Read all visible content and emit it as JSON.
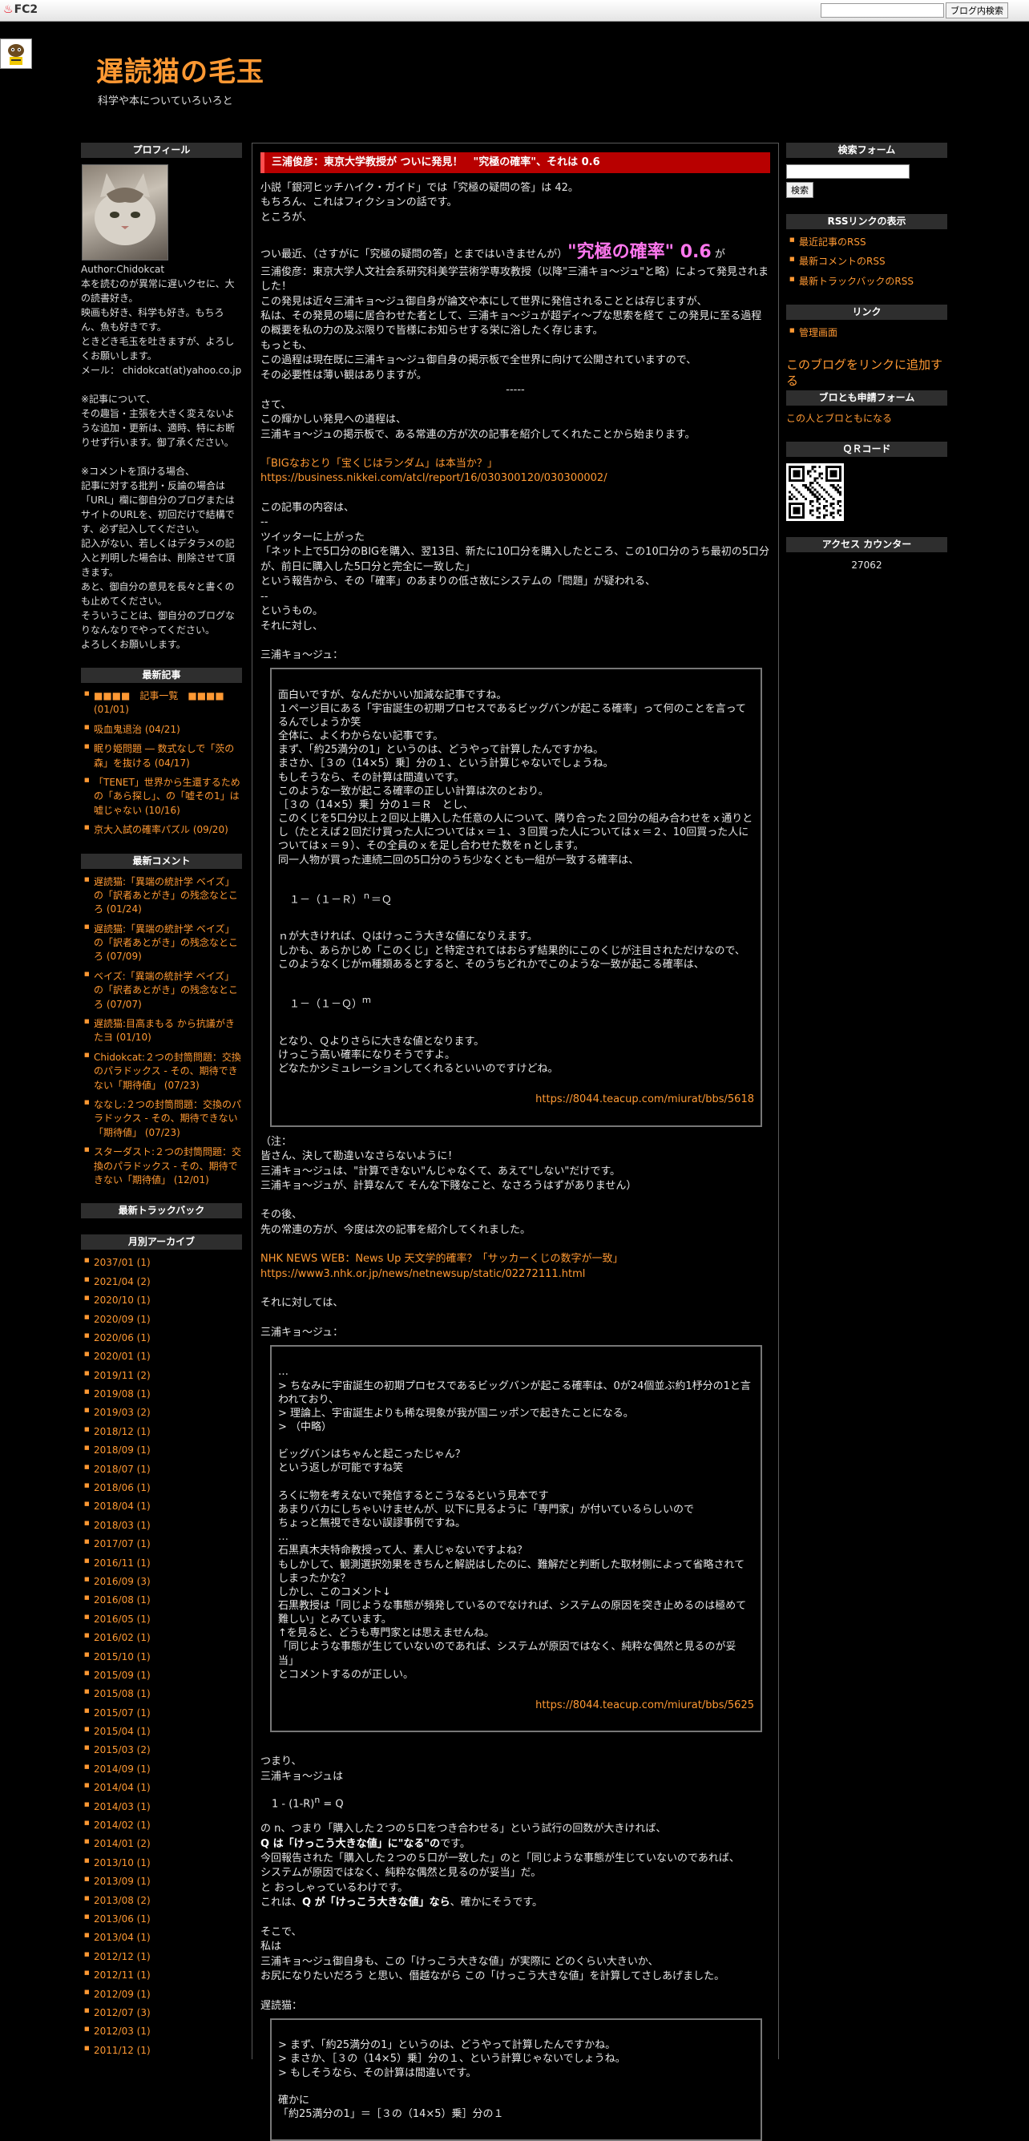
{
  "topbar": {
    "logo": "FC2",
    "search_placeholder": "",
    "blog_search_button": "ブログ内検索"
  },
  "header": {
    "title": "遅読猫の毛玉",
    "subtitle": "科学や本についていろいろと"
  },
  "profile": {
    "heading": "プロフィール",
    "author": "Author:Chidokcat",
    "text": "本を読むのが異常に遅いクセに、大の読書好き。\n映画も好き、科学も好き。もちろん、魚も好きです。\nときどき毛玉を吐きますが、よろしくお願いします。\nメール： chidokcat(at)yahoo.co.jp\n\n※記事について、\nその趣旨・主張を大きく変えないような追加・更新は、適時、特にお断りせず行います。御了承ください。\n\n※コメントを頂ける場合、\n記事に対する批判・反論の場合は「URL」欄に御自分のブログまたはサイトのURLを、初回だけで結構です、必ず記入してください。\n記入がない、若しくはデタラメの記入と判明した場合は、削除させて頂きます。\nあと、御自分の意見を長々と書くのも止めてください。\nそういうことは、御自分のブログなりなんなりでやってください。\nよろしくお願いします。"
  },
  "recent_articles": {
    "heading": "最新記事",
    "items": [
      "■■■■　記事一覧　■■■■ (01/01)",
      "吸血鬼退治 (04/21)",
      "眠り姫問題 ― 数式なしで「茨の森」を抜ける (04/17)",
      "「TENET」世界から生還するための「あら探し」、の「嘘その1」は嘘じゃない (10/16)",
      "京大入試の確率パズル (09/20)"
    ]
  },
  "recent_comments": {
    "heading": "最新コメント",
    "items": [
      "遅読猫:「異端の統計学 ベイズ」の「訳者あとがき」の残念なところ (01/24)",
      "遅読猫:「異端の統計学 ベイズ」の「訳者あとがき」の残念なところ (07/09)",
      "ベイズ:「異端の統計学 ベイズ」の「訳者あとがき」の残念なところ (07/07)",
      "遅読猫:目高まもる から抗議がきたヨ (01/10)",
      "Chidokcat:２つの封筒問題：交換のパラドックス - その、期待できない「期待値」 (07/23)",
      "ななし:２つの封筒問題：交換のパラドックス - その、期待できない「期待値」 (07/23)",
      "スターダスト:２つの封筒問題：交換のパラドックス - その、期待できない「期待値」 (12/01)"
    ]
  },
  "recent_trackbacks": {
    "heading": "最新トラックバック"
  },
  "archives": {
    "heading": "月別アーカイブ",
    "items": [
      "2037/01 (1)",
      "2021/04 (2)",
      "2020/10 (1)",
      "2020/09 (1)",
      "2020/06 (1)",
      "2020/01 (1)",
      "2019/11 (2)",
      "2019/08 (1)",
      "2019/03 (2)",
      "2018/12 (1)",
      "2018/09 (1)",
      "2018/07 (1)",
      "2018/06 (1)",
      "2018/04 (1)",
      "2018/03 (1)",
      "2017/07 (1)",
      "2016/11 (1)",
      "2016/09 (3)",
      "2016/08 (1)",
      "2016/05 (1)",
      "2016/02 (1)",
      "2015/10 (1)",
      "2015/09 (1)",
      "2015/08 (1)",
      "2015/07 (1)",
      "2015/04 (1)",
      "2015/03 (2)",
      "2014/09 (1)",
      "2014/04 (1)",
      "2014/03 (1)",
      "2014/02 (1)",
      "2014/01 (2)",
      "2013/10 (1)",
      "2013/09 (1)",
      "2013/08 (2)",
      "2013/06 (1)",
      "2013/04 (1)",
      "2012/12 (1)",
      "2012/11 (1)",
      "2012/09 (1)",
      "2012/07 (3)",
      "2012/03 (1)",
      "2011/12 (1)"
    ]
  },
  "search_form": {
    "heading": "検索フォーム",
    "input_value": "",
    "button": "検索"
  },
  "rss": {
    "heading": "RSSリンクの表示",
    "items": [
      "最近記事のRSS",
      "最新コメントのRSS",
      "最新トラックバックのRSS"
    ]
  },
  "links": {
    "heading": "リンク",
    "items": [
      "管理画面"
    ]
  },
  "add_link": "このブログをリンクに追加する",
  "friend_form": {
    "heading": "ブロとも申請フォーム",
    "link": "この人とブロともになる"
  },
  "qr": {
    "heading": "ＱＲコード"
  },
  "counter": {
    "heading": "アクセス カウンター",
    "value": "27062"
  },
  "article": {
    "title": "三浦俊彦：東京大学教授が ついに発見！　\"究極の確率\"、それは 0.6",
    "p1": "小説「銀河ヒッチハイク・ガイド」では「究極の疑問の答」は 42。\nもちろん、これはフィクションの話です。\nところが、",
    "p2a": "つい最近、（さすがに「究極の疑問の答」とまではいきませんが）",
    "p2big": "\"究極の確率\" 0.6",
    "p2b": " が",
    "p3": "三浦俊彦：東京大学人文社会系研究科美学芸術学専攻教授（以降\"三浦キョ～ジュ\"と略）によって発見されました！\nこの発見は近々三浦キョ～ジュ御自身が論文や本にして世界に発信されることとは存じますが、\n私は、その発見の場に居合わせた者として、三浦キョ～ジュが超ディ～プな思索を経て この発見に至る過程の概要を私の力の及ぶ限りで皆様にお知らせする栄に浴したく存じます。\nもっとも、\nこの過程は現在既に三浦キョ～ジュ御自身の掲示板で全世界に向けて公開されていますので、\nその必要性は薄い観はありますが。",
    "divider": "-----",
    "p4": "さて、\nこの輝かしい発見への道程は、\n三浦キョ～ジュの掲示板で、ある常連の方が次の記事を紹介してくれたことから始まります。",
    "link1_title": "「BIGなおとり「宝くじはランダム」は本当か？」",
    "link1_url": "https://business.nikkei.com/atcl/report/16/030300120/030300002/",
    "p5": "この記事の内容は、\n--\nツイッターに上がった\n「ネット上で5口分のBIGを購入、翌13日、新たに10口分を購入したところ、この10口分のうち最初の5口分が、前日に購入した5口分と完全に一致した」\nという報告から、その「確率」のあまりの低さ故にシステムの「問題」が疑われる、\n--\nというもの。\nそれに対し、",
    "speaker1": "三浦キョ～ジュ：",
    "quote1a": "面白いですが、なんだかいい加減な記事ですね。\n１ページ目にある「宇宙誕生の初期プロセスであるビッグバンが起こる確率」って何のことを言ってるんでしょうか笑\n全体に、よくわからない記事です。\nまず、「約25満分の1」というのは、どうやって計算したんですかね。\nまさか、［３の（14×5）乗］分の１、という計算じゃないでしょうね。\nもしそうなら、その計算は間違いです。\nこのような一致が起こる確率の正しい計算は次のとおり。\n［３の（14×5）乗］分の１＝Ｒ　とし、\nこのくじを5口分以上２回以上購入した任意の人について、隣り合った２回分の組み合わせをｘ通りとし（たとえば２回だけ買った人についてはｘ＝１、３回買った人についてはｘ＝２、10回買った人についてはｘ＝９）、その全員のｘを足し合わせた数をｎとします。\n同一人物が買った連続二回の5口分のうち少なくとも一組が一致する確率は、",
    "formula1": "１－（１－Ｒ）",
    "formula1_exp": "ｎ",
    "formula1_tail": "＝Ｑ",
    "quote1b": "ｎが大きければ、Ｑはけっこう大きな値になりえます。\nしかも、あらかじめ「このくじ」と特定されてはおらず結果的にこのくじが注目されただけなので、このようなくじがm種類あるとすると、そのうちどれかでこのような一致が起こる確率は、",
    "formula2": "１－（１－Ｑ）",
    "formula2_exp": "ｍ",
    "quote1c": "となり、Ｑよりさらに大きな値となります。\nけっこう高い確率になりそうですよ。\nどなたかシミュレーションしてくれるといいのですけどね。",
    "quote1_src": "https://8044.teacup.com/miurat/bbs/5618",
    "p6": "（注：\n皆さん、決して勘違いなさらないように！\n三浦キョ～ジュは、\"計算できない\"んじゃなくて、あえて\"しない\"だけです。\n三浦キョ～ジュが、計算なんて そんな下賤なこと、なさろうはずがありません）",
    "p7": "その後、\n先の常連の方が、今度は次の記事を紹介してくれました。",
    "link2_title": "NHK NEWS WEB：News Up 天文学的確率？「サッカーくじの数字が一致」",
    "link2_url": "https://www3.nhk.or.jp/news/netnewsup/static/02272111.html",
    "p8": "それに対しては、",
    "speaker2": "三浦キョ～ジュ：",
    "quote2": "…\n> ちなみに宇宙誕生の初期プロセスであるビッグバンが起こる確率は、0が24個並ぶ約1杼分の1と言われており、\n> 理論上、宇宙誕生よりも稀な現象が我が国ニッポンで起きたことになる。\n> （中略）\n\nビッグバンはちゃんと起こったじゃん？\nという返しが可能ですね笑\n\nろくに物を考えないで発信するとこうなるという見本です\nあまりバカにしちゃいけませんが、以下に見るように「専門家」が付いているらしいので\nちょっと無視できない誤謬事例ですね。\n…\n石黒真木夫特命教授って人、素人じゃないですよね？\nもしかして、観測選択効果をきちんと解説はしたのに、難解だと判断した取材側によって省略されてしまったかな？\nしかし、このコメント↓\n石黒教授は「同じような事態が頻発しているのでなければ、システムの原因を突き止めるのは極めて難しい」とみています。\n↑を見ると、どうも専門家とは思えませんね。\n「同じような事態が生じていないのであれば、システムが原因ではなく、純粋な偶然と見るのが妥当」\nとコメントするのが正しい。",
    "quote2_src": "https://8044.teacup.com/miurat/bbs/5625",
    "p9": "つまり、\n三浦キョ～ジュは",
    "formula3": "1 - (1-R)",
    "formula3_exp": "n",
    "formula3_tail": " = Q",
    "p10a": "の n、つまり「購入した２つの５口をつき合わせる」という試行の回数が大きければ、",
    "p10b_bold": "Q は「けっこう大きな値」に\"なる\"の",
    "p10b_tail": "です。",
    "p10c": "今回報告された「購入した２つの５口が一致した」のと「同じような事態が生じていないのであれば、\nシステムが原因ではなく、純粋な偶然と見るのが妥当」だ。\nと おっしゃっているわけです。",
    "p10d_a": "これは、",
    "p10d_bold": "Q が「けっこう大きな値」なら",
    "p10d_b": "、確かにそうです。",
    "p11": "そこで、\n私は\n三浦キョ～ジュ御自身も、この「けっこう大きな値」が実際に どのくらい大きいか、\nお尻になりたいだろう と思い、僭越ながら この「けっこう大きな値」を計算してさしあげました。",
    "speaker3": "遅読猫：",
    "quote3": "> まず、「約25満分の1」というのは、どうやって計算したんですかね。\n> まさか、［３の（14×5）乗］分の１、という計算じゃないでしょうね。\n> もしそうなら、その計算は間違いです。\n\n確かに\n「約25満分の1」＝［３の（14×5）乗］分の１"
  }
}
